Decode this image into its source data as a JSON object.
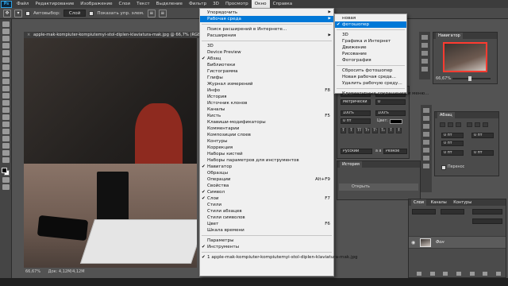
{
  "app": {
    "logo": "Ps"
  },
  "menubar": {
    "items": [
      {
        "label": "Файл"
      },
      {
        "label": "Редактирование"
      },
      {
        "label": "Изображение"
      },
      {
        "label": "Слои"
      },
      {
        "label": "Текст"
      },
      {
        "label": "Выделение"
      },
      {
        "label": "Фильтр"
      },
      {
        "label": "3D"
      },
      {
        "label": "Просмотр"
      },
      {
        "label": "Окно",
        "active": true
      },
      {
        "label": "Справка"
      }
    ]
  },
  "options_bar": {
    "autoselect_label": "Автовыбор:",
    "autoselect_value": "Слой",
    "transform_label": "Показать упр. элем."
  },
  "document": {
    "tab_title": "apple-mak-kompiuter-kompiutemyi-stol-diplen-klaviatura-mak.jpg @ 66,7% (RGB/8#)",
    "tab_close": "×",
    "status_zoom": "66,67%",
    "status_doc": "Док: 4,12M/4,12M"
  },
  "window_menu": {
    "items": [
      {
        "label": "Упорядочить",
        "arrow": true
      },
      {
        "label": "Рабочая среда",
        "arrow": true,
        "highlight": true
      },
      {
        "sep": true
      },
      {
        "label": "Поиск расширений в Интернете..."
      },
      {
        "label": "Расширения",
        "arrow": true
      },
      {
        "sep": true
      },
      {
        "label": "3D"
      },
      {
        "label": "Device Preview"
      },
      {
        "label": "Абзац",
        "check": true
      },
      {
        "label": "Библиотеки"
      },
      {
        "label": "Гистограмма"
      },
      {
        "label": "Глифы"
      },
      {
        "label": "Журнал измерений"
      },
      {
        "label": "Инфо",
        "shortcut": "F8"
      },
      {
        "label": "История"
      },
      {
        "label": "Источник клонов"
      },
      {
        "label": "Каналы"
      },
      {
        "label": "Кисть",
        "shortcut": "F5"
      },
      {
        "label": "Клавиши-модификаторы"
      },
      {
        "label": "Комментарии"
      },
      {
        "label": "Композиции слоев"
      },
      {
        "label": "Контуры"
      },
      {
        "label": "Коррекция"
      },
      {
        "label": "Наборы кистей"
      },
      {
        "label": "Наборы параметров для инструментов"
      },
      {
        "label": "Навигатор",
        "check": true
      },
      {
        "label": "Образцы"
      },
      {
        "label": "Операции",
        "shortcut": "Alt+F9"
      },
      {
        "label": "Свойства"
      },
      {
        "label": "Символ",
        "check": true
      },
      {
        "label": "Слои",
        "check": true,
        "shortcut": "F7"
      },
      {
        "label": "Стили"
      },
      {
        "label": "Стили абзацев"
      },
      {
        "label": "Стили символов"
      },
      {
        "label": "Цвет",
        "shortcut": "F6"
      },
      {
        "label": "Шкала времени"
      },
      {
        "sep": true
      },
      {
        "label": "Параметры"
      },
      {
        "label": "Инструменты",
        "check": true
      },
      {
        "sep": true
      },
      {
        "label": "1 apple-mak-kompiuter-kompiutemyi-stol-diplen-klaviatura-mak.jpg",
        "check": true
      }
    ]
  },
  "workspace_menu": {
    "items": [
      {
        "label": "новая"
      },
      {
        "label": "фотошопер",
        "check": true,
        "highlight": true
      },
      {
        "sep": true
      },
      {
        "label": "3D"
      },
      {
        "label": "Графика и Интернет"
      },
      {
        "label": "Движение"
      },
      {
        "label": "Рисование"
      },
      {
        "label": "Фотография"
      },
      {
        "sep": true
      },
      {
        "label": "Сбросить фотошопер"
      },
      {
        "label": "Новая рабочая среда..."
      },
      {
        "label": "Удалить рабочую среду..."
      },
      {
        "sep": true
      },
      {
        "label": "Клавиатурные сокращения и меню..."
      }
    ]
  },
  "navigator_panel": {
    "title": "Навигатор",
    "zoom": "66,67%",
    "zoom_fraction": 0.45
  },
  "char_panel": {
    "size_value": "60 пт",
    "leading_value": "75 пт",
    "tracking_value": "Метрически",
    "kerning_value": "0",
    "scale_v": "100%",
    "scale_h": "100%",
    "baseline": "0 пт",
    "color_label": "Цвет:",
    "language": "Русский",
    "aa_label": "а а",
    "aa_value": "Резкое",
    "format_buttons": [
      "T",
      "T",
      "TT",
      "Tт",
      "T¹",
      "T₁",
      "T",
      "Ŧ"
    ]
  },
  "paragraph_panel": {
    "title": "Абзац",
    "indent_left": "0 пт",
    "indent_right": "0 пт",
    "indent_first": "0 пт",
    "space_before": "0 пт",
    "space_after": "0 пт",
    "hyphenate_label": "Перенос"
  },
  "history_panel": {
    "title": "История",
    "item": "Открыть"
  },
  "layers_panel": {
    "tabs": [
      "Слои",
      "Каналы",
      "Контуры"
    ],
    "layer_name": "Фон"
  }
}
